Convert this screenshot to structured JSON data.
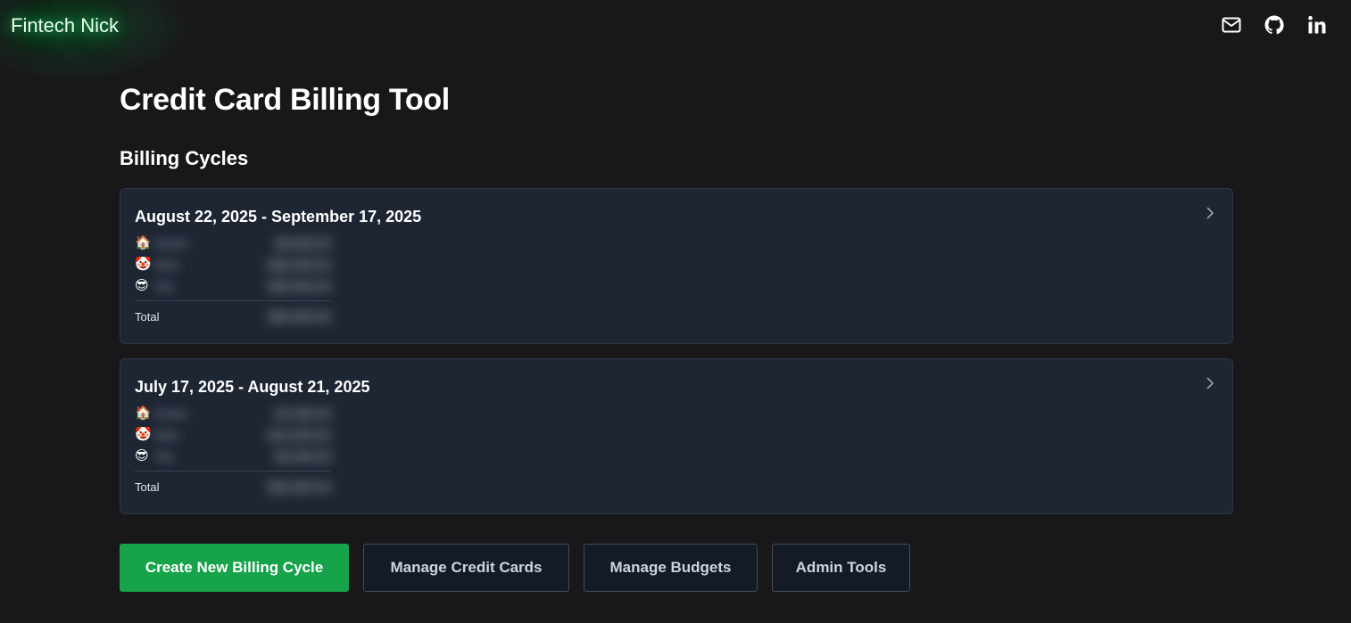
{
  "header": {
    "brand": "Fintech Nick",
    "icons": [
      "mail-icon",
      "github-icon",
      "linkedin-icon"
    ]
  },
  "page": {
    "title": "Credit Card Billing Tool",
    "section_title": "Billing Cycles"
  },
  "cycles": [
    {
      "date_range": "August 22, 2025 - September 17, 2025",
      "rows": [
        {
          "emoji": "🏠",
          "name": "Home",
          "amount": "$0,000.00"
        },
        {
          "emoji": "🤡",
          "name": "Nick",
          "amount": "$00,000.00"
        },
        {
          "emoji": "😎",
          "name": "Tas",
          "amount": "$00,000.00"
        }
      ],
      "total_label": "Total",
      "total_amount": "$00,000.00"
    },
    {
      "date_range": "July 17, 2025 - August 21, 2025",
      "rows": [
        {
          "emoji": "🏠",
          "name": "Home",
          "amount": "$7,000.03"
        },
        {
          "emoji": "🤡",
          "name": "Nick",
          "amount": "$10,000.02"
        },
        {
          "emoji": "😎",
          "name": "Tas",
          "amount": "$2,000.59"
        }
      ],
      "total_label": "Total",
      "total_amount": "$20,000.04"
    }
  ],
  "actions": {
    "create_label": "Create New Billing Cycle",
    "cards_label": "Manage Credit Cards",
    "budgets_label": "Manage Budgets",
    "admin_label": "Admin Tools"
  },
  "colors": {
    "background": "#18181b",
    "card": "#1e2533",
    "primary": "#16a34a",
    "glow": "#22c55e"
  }
}
